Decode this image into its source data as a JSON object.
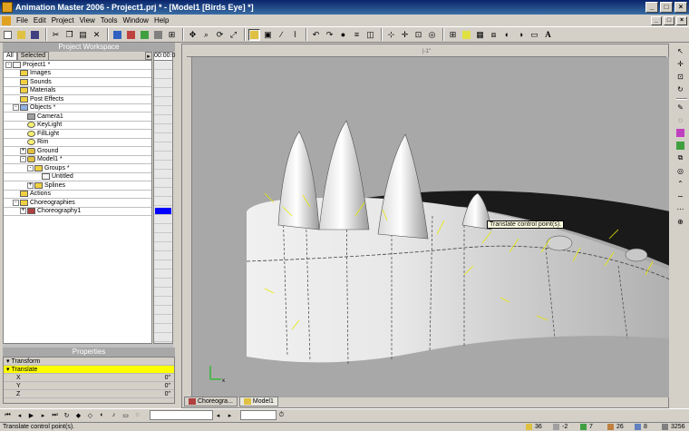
{
  "window": {
    "title": "Animation Master 2006 - Project1.prj * - [Model1 [Birds Eye] *]"
  },
  "menu": [
    "File",
    "Edit",
    "Project",
    "View",
    "Tools",
    "Window",
    "Help"
  ],
  "workspace": {
    "header": "Project Workspace",
    "tabs": [
      "All",
      "Selected"
    ],
    "timeline_label": "00:00:0",
    "tree": [
      {
        "label": "Project1 *",
        "icon": "project-icon",
        "expander": "-",
        "level": 0
      },
      {
        "label": "Images",
        "icon": "folder-icon",
        "level": 1
      },
      {
        "label": "Sounds",
        "icon": "folder-icon",
        "level": 1
      },
      {
        "label": "Materials",
        "icon": "folder-icon",
        "level": 1
      },
      {
        "label": "Post Effects",
        "icon": "folder-icon",
        "level": 1
      },
      {
        "label": "Objects *",
        "icon": "objects-icon",
        "expander": "-",
        "level": 1
      },
      {
        "label": "Camera1",
        "icon": "camera-icon",
        "level": 2
      },
      {
        "label": "KeyLight",
        "icon": "light-icon",
        "level": 2
      },
      {
        "label": "FillLight",
        "icon": "light-icon",
        "level": 2
      },
      {
        "label": "Rim",
        "icon": "light-icon",
        "level": 2
      },
      {
        "label": "Ground",
        "icon": "model-icon",
        "expander": "+",
        "level": 2
      },
      {
        "label": "Model1 *",
        "icon": "model-icon",
        "expander": "-",
        "level": 2
      },
      {
        "label": "Groups *",
        "icon": "folder-icon",
        "expander": "-",
        "level": 3
      },
      {
        "label": "Untitled",
        "icon": "group-icon",
        "level": 4
      },
      {
        "label": "Splines",
        "icon": "folder-icon",
        "expander": "+",
        "level": 3
      },
      {
        "label": "Actions",
        "icon": "folder-icon",
        "level": 1
      },
      {
        "label": "Choreographies",
        "icon": "folder-icon",
        "expander": "-",
        "level": 1
      },
      {
        "label": "Choreography1",
        "icon": "choreography-icon",
        "expander": "+",
        "level": 2
      }
    ]
  },
  "properties": {
    "header": "Properties",
    "rows": [
      {
        "label": "Transform",
        "value": "",
        "expander": "-"
      },
      {
        "label": "Translate",
        "value": "",
        "highlight": true,
        "expander": "-"
      },
      {
        "label": "X",
        "value": "0\"",
        "indent": true
      },
      {
        "label": "Y",
        "value": "0\"",
        "indent": true
      },
      {
        "label": "Z",
        "value": "0\"",
        "indent": true
      }
    ]
  },
  "viewport": {
    "ruler_label": "|-1\"",
    "tooltip": "Translate control point(s).",
    "axis_label": "x"
  },
  "view_tabs": [
    "Choreogra...",
    "Model1"
  ],
  "status": {
    "message": "Translate control point(s).",
    "counters": [
      "36",
      "-2",
      "7",
      "26",
      "8",
      "3256"
    ]
  },
  "colors": {
    "title_bar": "#0a246a",
    "highlight": "#ffff00",
    "timeline_marker": "#0000ff",
    "tooltip_bg": "#ffffe1",
    "viewport_bg": "#a8a8a8"
  }
}
